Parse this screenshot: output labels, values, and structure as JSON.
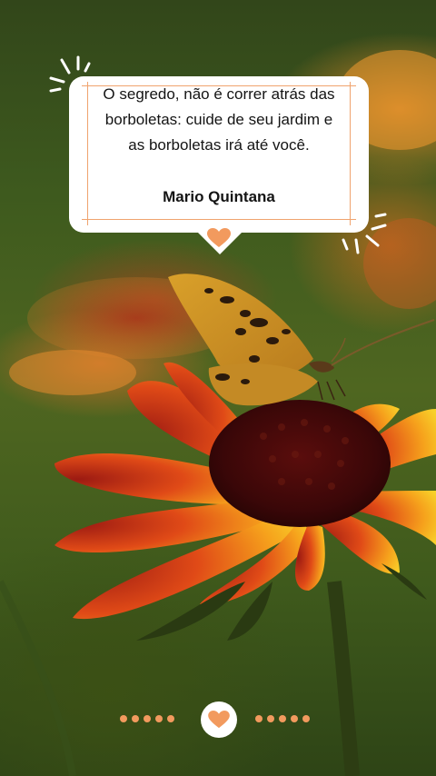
{
  "quote": {
    "line1": "O segredo, não é correr atrás das",
    "line2": "borboletas: cuide de seu jardim e",
    "line3": "as borboletas irá até você.",
    "author": "Mario Quintana"
  },
  "colors": {
    "accent": "#f29a5e",
    "card": "#ffffff",
    "text": "#141414"
  },
  "icons": {
    "card_heart": "heart-icon",
    "bottom_heart": "heart-icon",
    "sparkles": "sparkle-icon"
  }
}
